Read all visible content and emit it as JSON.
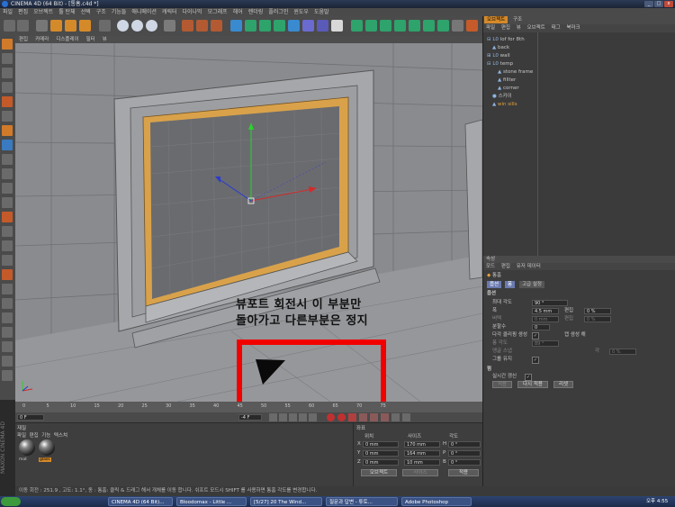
{
  "window": {
    "title": "CINEMA 4D (64 Bit) - [통홈.c4d *]"
  },
  "menu": [
    "파일",
    "편집",
    "오브젝트",
    "툴 탄체",
    "선택",
    "구조",
    "기능들",
    "애니메이션",
    "캐릭터",
    "다이나믹",
    "모그래프",
    "헤어",
    "렌더링",
    "플러그인",
    "윈도우",
    "도움말"
  ],
  "viewport": {
    "menu": [
      "편집",
      "카메라",
      "디스플레이",
      "필터",
      "뷰"
    ],
    "annotation_line1": "뷰포트 회전시 이 부분만",
    "annotation_line2": "돌아가고 다른부분은 정지",
    "colors": {
      "highlight_box": "#f20000",
      "window_frame": "#d9a24a"
    }
  },
  "timeline": {
    "ticks": [
      "0",
      "5",
      "10",
      "15",
      "20",
      "25",
      "30",
      "35",
      "40",
      "45",
      "50",
      "55",
      "60",
      "65",
      "70",
      "75"
    ],
    "start_field": "0 F",
    "end_field": "-4 F"
  },
  "materials": {
    "menu": [
      "재질",
      "파일",
      "편집",
      "기능",
      "텍스쳐"
    ],
    "items": [
      {
        "name": "mat"
      },
      {
        "name": "glass"
      }
    ]
  },
  "coordinates": {
    "title": "좌표",
    "headers": [
      "위치",
      "사이즈",
      "각도"
    ],
    "rows": [
      {
        "axis": "X",
        "pos": "0 mm",
        "size": "170 mm",
        "rot_label": "H",
        "rot": "0 °"
      },
      {
        "axis": "Y",
        "pos": "0 mm",
        "size": "164 mm",
        "rot_label": "P",
        "rot": "0 °"
      },
      {
        "axis": "Z",
        "pos": "0 mm",
        "size": "10 mm",
        "rot_label": "B",
        "rot": "0 °"
      }
    ],
    "mode_select": "오브젝트",
    "size_select": "사이즈",
    "apply_button": "적용"
  },
  "object_manager": {
    "tabs": [
      "오브젝트",
      "구조"
    ],
    "menu": [
      "파일",
      "편집",
      "뷰",
      "오브젝트",
      "태그",
      "북마크"
    ],
    "objects": [
      {
        "name": "lof for 8th",
        "indent": 0
      },
      {
        "name": "back",
        "indent": 1
      },
      {
        "name": "wall",
        "indent": 0
      },
      {
        "name": "temp",
        "indent": 0
      },
      {
        "name": "stone frame",
        "indent": 2
      },
      {
        "name": "fillter",
        "indent": 2
      },
      {
        "name": "corner",
        "indent": 2
      },
      {
        "name": "스카이",
        "indent": 1
      },
      {
        "name": "win sills",
        "indent": 1
      }
    ]
  },
  "attributes": {
    "header": "속성",
    "menu": [
      "모드",
      "편집",
      "유저 데이터"
    ],
    "object_name": "통홈",
    "tabs": [
      "옵션",
      "퐁",
      "고급 설정"
    ],
    "section": "옵션",
    "rows": [
      {
        "label": "최대 각도",
        "value": "90 °"
      },
      {
        "label": "폭",
        "value": "4.5 mm",
        "extra_label": "편집",
        "extra_value": "0 %"
      },
      {
        "label": "버텍",
        "value": "0 mm",
        "extra_label": "편집",
        "extra_value": "0 %"
      },
      {
        "label": "분할수",
        "value": "0"
      },
      {
        "label": "다각 클리핑 생성",
        "value": "",
        "extra_label": "캡 생성 해",
        "extra_value": ""
      },
      {
        "label": "퐁 각도",
        "value": "89 °"
      },
      {
        "label": "앵글 스냅",
        "value": "",
        "extra_label": "각",
        "extra_value": "0 %"
      },
      {
        "label": "그룹 유지",
        "value": ""
      }
    ],
    "subsection": "펌",
    "realtime_label": "실시간 갱신",
    "buttons": [
      "적용",
      "다시 적용",
      "리셋"
    ]
  },
  "status_bar": "이동 회전 : 251.9 , 고도: 1.1°, 동 : 통홈: 클릭 & 드래그 해서 개체를 이동 합니다. 쉬프트 모드시 SHIFT 를 사용하면 통홈 각도를 변경합니다.",
  "taskbar": {
    "items": [
      "CINEMA 4D (64 Bit)...",
      "Bloodomax - Little ...",
      "[5/27] 20 The Wind...",
      "질문과 답변 - 튜토...",
      "Adobe Photoshop"
    ],
    "clock": "오후 4:55"
  }
}
